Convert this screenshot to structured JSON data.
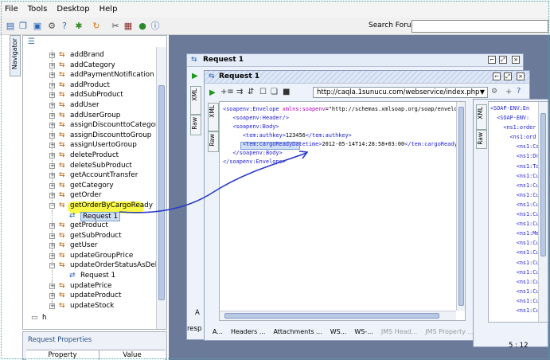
{
  "menu": [
    "File",
    "Tools",
    "Desktop",
    "Help"
  ],
  "toolbar": {
    "icons": [
      "doc-icon",
      "copy-icon",
      "save-icon",
      "prefs-icon",
      "help-icon",
      "bug-icon",
      "refresh-icon",
      "cut-icon",
      "grid-icon",
      "globe-icon",
      "info-icon"
    ],
    "search_label": "Search Forum",
    "search_value": ""
  },
  "navigator": {
    "tab_label": "Navigator",
    "items": [
      {
        "label": "addBrand",
        "expander": "+",
        "indent": 0
      },
      {
        "label": "addCategory",
        "expander": "+",
        "indent": 0
      },
      {
        "label": "addPaymentNotification",
        "expander": "+",
        "indent": 0
      },
      {
        "label": "addProduct",
        "expander": "+",
        "indent": 0
      },
      {
        "label": "addSubProduct",
        "expander": "+",
        "indent": 0
      },
      {
        "label": "addUser",
        "expander": "+",
        "indent": 0
      },
      {
        "label": "addUserGroup",
        "expander": "+",
        "indent": 0
      },
      {
        "label": "assignDiscounttoCategory",
        "expander": "+",
        "indent": 0
      },
      {
        "label": "assignDiscounttoGroup",
        "expander": "+",
        "indent": 0
      },
      {
        "label": "assignUsertoGroup",
        "expander": "+",
        "indent": 0
      },
      {
        "label": "deleteProduct",
        "expander": "+",
        "indent": 0
      },
      {
        "label": "deleteSubProduct",
        "expander": "+",
        "indent": 0
      },
      {
        "label": "getAccountTransfer",
        "expander": "+",
        "indent": 0
      },
      {
        "label": "getCategory",
        "expander": "+",
        "indent": 0
      },
      {
        "label": "getOrder",
        "expander": "+",
        "indent": 0
      },
      {
        "label": "getOrderByCargoReady",
        "expander": "−",
        "indent": 0,
        "highlight": true
      },
      {
        "label": "Request 1",
        "expander": "",
        "indent": 1,
        "selected": true
      },
      {
        "label": "getProduct",
        "expander": "+",
        "indent": 0
      },
      {
        "label": "getSubProduct",
        "expander": "+",
        "indent": 0
      },
      {
        "label": "getUser",
        "expander": "+",
        "indent": 0
      },
      {
        "label": "updateGroupPrice",
        "expander": "+",
        "indent": 0
      },
      {
        "label": "updateOrderStatusAsDelivere",
        "expander": "−",
        "indent": 0
      },
      {
        "label": "Request 1",
        "expander": "",
        "indent": 1
      },
      {
        "label": "updatePrice",
        "expander": "+",
        "indent": 0
      },
      {
        "label": "updateProduct",
        "expander": "+",
        "indent": 0
      },
      {
        "label": "updateStock",
        "expander": "+",
        "indent": 0
      }
    ],
    "footer_item": "h"
  },
  "request_properties": {
    "title": "Request Properties",
    "col_property": "Property",
    "col_value": "Value"
  },
  "outer_window": {
    "title": "Request 1",
    "side_tabs": [
      "XML",
      "Raw"
    ],
    "bottom_left": "A",
    "bottom_left2": "resp"
  },
  "inner_window": {
    "title": "Request 1",
    "url": "http://caqla.1sunucu.com/webservice/index.php",
    "side_tabs": [
      "XML",
      "Raw"
    ],
    "xml_lines": [
      [
        {
          "c": "tg",
          "t": "<soapenv:Envelope "
        },
        {
          "c": "at",
          "t": "xmlns:soapenv"
        },
        {
          "c": "tx",
          "t": "=\"http://schemas.xmlsoap.org/soap/envelope/\" "
        },
        {
          "c": "at",
          "t": "xmlns"
        }
      ],
      [
        {
          "c": "tx",
          "t": "   "
        },
        {
          "c": "tg",
          "t": "<soapenv:Header/>"
        }
      ],
      [
        {
          "c": "tx",
          "t": "   "
        },
        {
          "c": "tg",
          "t": "<soapenv:Body>"
        }
      ],
      [
        {
          "c": "tx",
          "t": "      "
        },
        {
          "c": "tg",
          "t": "<tem:authkey>"
        },
        {
          "c": "tx",
          "t": "123456"
        },
        {
          "c": "tg",
          "t": "</tem:authkey>"
        }
      ],
      [
        {
          "c": "tx",
          "t": "      "
        },
        {
          "c": "tg",
          "t": "<tem:cargoReadyDatetime>"
        },
        {
          "c": "tx",
          "t": "2012-05-14T14:28:58+03:00"
        },
        {
          "c": "tg",
          "t": "</tem:cargoReadyDatetime>"
        }
      ],
      [
        {
          "c": "tx",
          "t": "   "
        },
        {
          "c": "tg",
          "t": "</soapenv:Body>"
        }
      ],
      [
        {
          "c": "tg",
          "t": "</soapenv:Envelope>"
        }
      ]
    ],
    "bottom_tabs": [
      {
        "label": "A...",
        "disabled": false
      },
      {
        "label": "Headers ...",
        "disabled": false
      },
      {
        "label": "Attachments ...",
        "disabled": false
      },
      {
        "label": "WS...",
        "disabled": false
      },
      {
        "label": "WS-...",
        "disabled": false
      },
      {
        "label": "JMS Head...",
        "disabled": true
      },
      {
        "label": "JMS Property ...",
        "disabled": true
      }
    ]
  },
  "response_window": {
    "side_tabs": [
      "XML",
      "Raw"
    ],
    "lines": [
      "<SOAP-ENV:En",
      "  <SOAP-ENV:",
      "    <ns1:order",
      "      <ns1:ord",
      "        <ns1:Ca",
      "        <ns1:Dr",
      "        <ns1:To",
      "        <ns1:Cu",
      "        <ns1:Cu",
      "        <ns1:Cu",
      "        <ns1:Cu",
      "        <ns1:Cu",
      "        <ns1:Cu",
      "        <ns1:Me",
      "        <ns1:Cu",
      "        <ns1:Cu",
      "        <ns1:Cu",
      "        <ns1:Cu",
      "        <ns1:Cu",
      "        <ns1:Cu",
      "        <ns1:Cu",
      "        <ns1:Cu"
    ],
    "cursor_pos": "5 : 12"
  }
}
